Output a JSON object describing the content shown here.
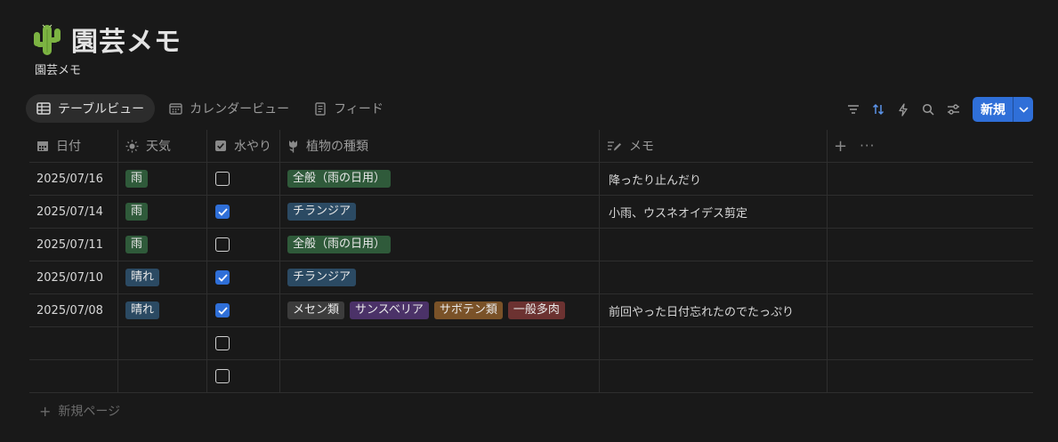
{
  "page": {
    "title": "園芸メモ",
    "subtitle": "園芸メモ"
  },
  "views": [
    {
      "label": "テーブルビュー",
      "icon": "table-icon",
      "active": true
    },
    {
      "label": "カレンダービュー",
      "icon": "calendar-icon",
      "active": false
    },
    {
      "label": "フィード",
      "icon": "feed-icon",
      "active": false
    }
  ],
  "toolbar": {
    "new_label": "新規"
  },
  "columns": [
    {
      "label": "日付",
      "icon": "calendar-icon"
    },
    {
      "label": "天気",
      "icon": "sun-icon"
    },
    {
      "label": "水やり",
      "icon": "checkbox-icon"
    },
    {
      "label": "植物の種類",
      "icon": "tulip-icon"
    },
    {
      "label": "メモ",
      "icon": "pen-lines-icon"
    }
  ],
  "rows": [
    {
      "date": "2025/07/16",
      "weather": "雨",
      "watered": false,
      "plants": [
        "全般（雨の日用）"
      ],
      "memo": "降ったり止んだり"
    },
    {
      "date": "2025/07/14",
      "weather": "雨",
      "watered": true,
      "plants": [
        "チランジア"
      ],
      "memo": "小雨、ウスネオイデス剪定"
    },
    {
      "date": "2025/07/11",
      "weather": "雨",
      "watered": false,
      "plants": [
        "全般（雨の日用）"
      ],
      "memo": ""
    },
    {
      "date": "2025/07/10",
      "weather": "晴れ",
      "watered": true,
      "plants": [
        "チランジア"
      ],
      "memo": ""
    },
    {
      "date": "2025/07/08",
      "weather": "晴れ",
      "watered": true,
      "plants": [
        "メセン類",
        "サンスベリア",
        "サボテン類",
        "一般多肉"
      ],
      "memo": "前回やった日付忘れたのでたっぷり"
    },
    {
      "date": "",
      "weather": "",
      "watered": false,
      "plants": [],
      "memo": ""
    },
    {
      "date": "",
      "weather": "",
      "watered": false,
      "plants": [],
      "memo": ""
    }
  ],
  "tag_colors": {
    "雨": "#2f5a3a",
    "晴れ": "#2b4a63",
    "全般（雨の日用）": "#2f5a3a",
    "チランジア": "#2b4a63",
    "メセン類": "#3c3c3c",
    "サンスベリア": "#4b3268",
    "サボテン類": "#7a5228",
    "一般多肉": "#6c3231"
  },
  "footer": {
    "new_page_label": "新規ページ"
  },
  "colors": {
    "accent": "#2f6fd8",
    "background": "#191919"
  }
}
